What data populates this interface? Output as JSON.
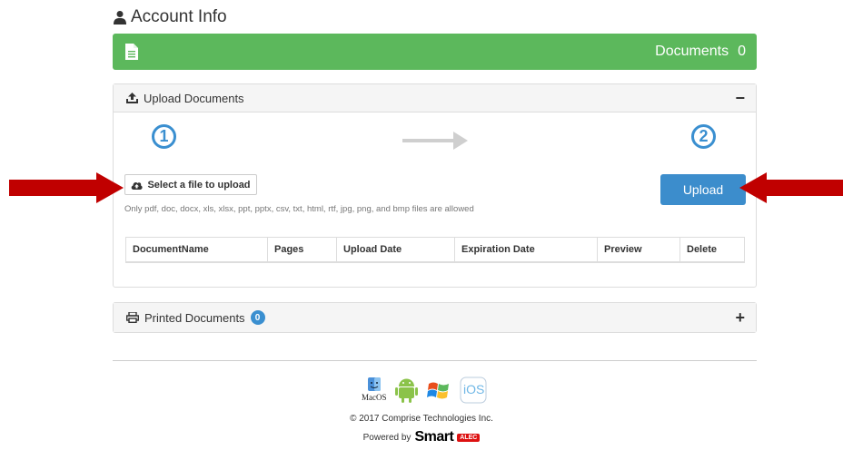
{
  "page": {
    "title": "Account Info"
  },
  "banner": {
    "label": "Documents",
    "count": "0",
    "color": "#5cb85c"
  },
  "upload_panel": {
    "title": "Upload Documents",
    "toggle": "−",
    "step1": "1",
    "step2": "2",
    "select_label": "Select a file to upload",
    "allowed_text": "Only pdf, doc, docx, xls, xlsx, ppt, pptx, csv, txt, html, rtf, jpg, png, and bmp files are allowed",
    "upload_label": "Upload",
    "table_headers": [
      "DocumentName",
      "Pages",
      "Upload Date",
      "Expiration Date",
      "Preview",
      "Delete"
    ]
  },
  "printed_panel": {
    "title": "Printed Documents",
    "count": "0",
    "toggle": "+"
  },
  "footer": {
    "os_icons": [
      "macos-icon",
      "android-icon",
      "windows-icon",
      "ios-icon"
    ],
    "macos_label": "MacOS",
    "ios_label": "iOS",
    "copyright": "© 2017 Comprise Technologies Inc.",
    "powered_by": "Powered by",
    "brand": "Smart",
    "brand_badge": "ALEC"
  },
  "colors": {
    "accent_blue": "#3c8dcc",
    "arrow_red": "#c00000",
    "gray_arrow": "#cfcfcf"
  }
}
